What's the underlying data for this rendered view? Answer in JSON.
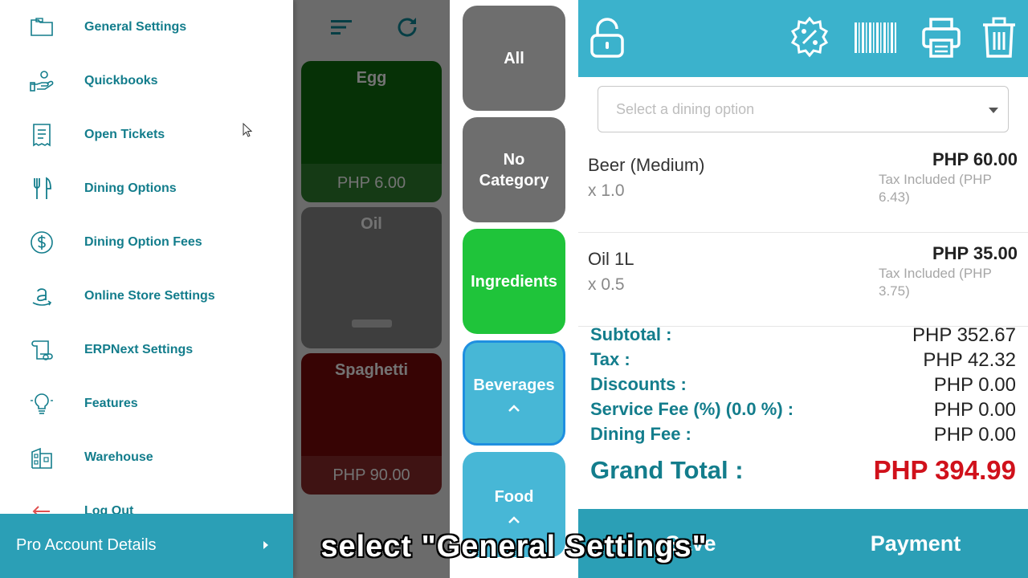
{
  "menu": {
    "items": [
      {
        "label": "General Settings"
      },
      {
        "label": "Quickbooks"
      },
      {
        "label": "Open Tickets"
      },
      {
        "label": "Dining Options"
      },
      {
        "label": "Dining Option Fees"
      },
      {
        "label": "Online Store Settings"
      },
      {
        "label": "ERPNext Settings"
      },
      {
        "label": "Features"
      },
      {
        "label": "Warehouse"
      },
      {
        "label": "Log Out"
      }
    ],
    "pro_account_label": "Pro Account Details"
  },
  "products": [
    {
      "name": "Egg",
      "price": "PHP 6.00",
      "color": "#0e6e0e"
    },
    {
      "name": "Oil",
      "price": "",
      "color": "#8a8a8a"
    },
    {
      "name": "Spaghetti",
      "price": "PHP 90.00",
      "color": "#7a0a0a"
    }
  ],
  "categories": [
    {
      "label": "All",
      "color": "#6e6e6e"
    },
    {
      "label": "No Category",
      "color": "#6e6e6e"
    },
    {
      "label": "Ingredients",
      "color": "#1fc43a"
    },
    {
      "label": "Beverages",
      "color": "#47b7d6"
    },
    {
      "label": "Food",
      "color": "#47b7d6"
    }
  ],
  "order": {
    "dining_placeholder": "Select a dining option",
    "items": [
      {
        "name": "Beer (Medium)",
        "qty": "x 1.0",
        "price": "PHP 60.00",
        "tax": "Tax Included (PHP 6.43)"
      },
      {
        "name": "Oil 1L",
        "qty": "x 0.5",
        "price": "PHP 35.00",
        "tax": "Tax Included (PHP 3.75)"
      }
    ],
    "totals": {
      "subtotal_label": "Subtotal :",
      "subtotal_value": "PHP 352.67",
      "tax_label": "Tax :",
      "tax_value": "PHP 42.32",
      "discounts_label": "Discounts :",
      "discounts_value": "PHP 0.00",
      "service_fee_label": "Service Fee (%) (0.0 %) :",
      "service_fee_value": "PHP 0.00",
      "dining_fee_label": "Dining Fee :",
      "dining_fee_value": "PHP 0.00",
      "grand_total_label": "Grand Total :",
      "grand_total_value": "PHP 394.99"
    },
    "save_label": "Save",
    "payment_label": "Payment"
  },
  "caption": "select \"General Settings\"",
  "colors": {
    "teal_header": "#3bb2cc",
    "teal_footer": "#2b9fb6",
    "teal_text": "#137d8c",
    "grand_total_red": "#d0111b"
  },
  "icons": [
    "folder-icon",
    "hand-coin-icon",
    "receipt-icon",
    "fork-knife-icon",
    "dollar-circle-icon",
    "amazon-icon",
    "scroll-icon",
    "lightbulb-icon",
    "building-icon",
    "logout-icon",
    "sort-icon",
    "refresh-icon",
    "unlock-icon",
    "discount-badge-icon",
    "barcode-icon",
    "printer-icon",
    "trash-icon"
  ]
}
